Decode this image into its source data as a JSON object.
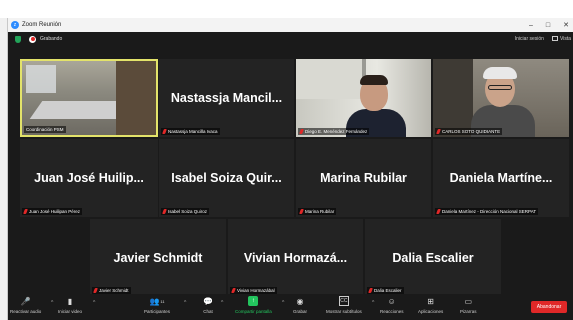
{
  "window": {
    "title": "Zoom Reunión",
    "controls": {
      "minimize": "–",
      "maximize": "□",
      "close": "✕"
    }
  },
  "infobar": {
    "recording_label": "Grabando",
    "exit_fullscreen": "Iniciar sesión",
    "view_label": "Vista"
  },
  "participants": [
    {
      "display": "",
      "label": "Coordinación PSM",
      "type": "video-room"
    },
    {
      "display": "Nastassja Mancil...",
      "label": "Nastassja Mancilla Ivaca",
      "type": "name"
    },
    {
      "display": "",
      "label": "Diego E. Menéndez Fernández",
      "type": "video-cam1"
    },
    {
      "display": "",
      "label": "CARLOS SOTO QUIDIANTE",
      "type": "video-cam2"
    },
    {
      "display": "Juan José Huilip...",
      "label": "Juan José Huilipan Pérez",
      "type": "name"
    },
    {
      "display": "Isabel Soiza Quir...",
      "label": "Isabel Soiza Quiroz",
      "type": "name"
    },
    {
      "display": "Marina Rubilar",
      "label": "Marina Rubilar",
      "type": "name"
    },
    {
      "display": "Daniela Martíne...",
      "label": "Daniela Martínez - Dirección Nacional SERPAT",
      "type": "name"
    },
    {
      "display": "Javier Schmidt",
      "label": "Javier Schmidt",
      "type": "name"
    },
    {
      "display": "Vivian Hormazá...",
      "label": "Vivian Hormazábal",
      "type": "name"
    },
    {
      "display": "Dalia Escalier",
      "label": "Dalia Escalier",
      "type": "name"
    }
  ],
  "toolbar": {
    "unmute": "Reactivar audio",
    "start_video": "Iniciar video",
    "participants": "Participantes",
    "participants_count": "11",
    "chat": "Chat",
    "share_screen": "Compartir pantalla",
    "record": "Grabar",
    "captions": "Mostrar subtítulos",
    "reactions": "Reacciones",
    "apps": "Aplicaciones",
    "whiteboards": "Pizarras",
    "leave": "Abandonar"
  },
  "colors": {
    "active_speaker": "#e3e36a",
    "share_green": "#23c55e",
    "leave_red": "#e02828",
    "background": "#1a1a1a"
  }
}
